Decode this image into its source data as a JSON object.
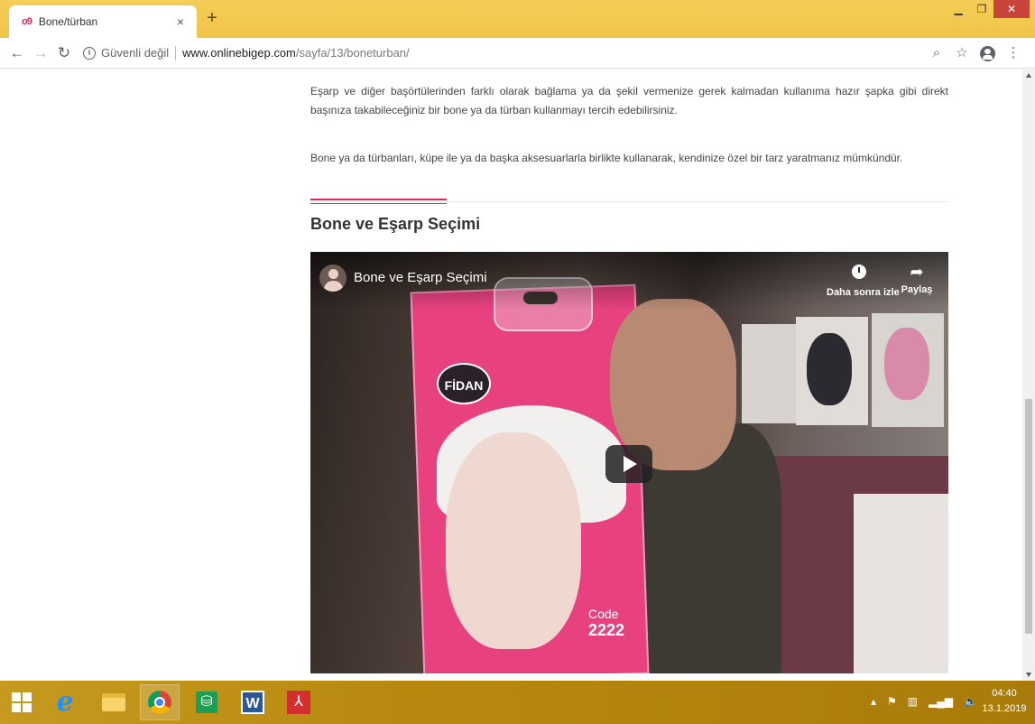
{
  "browser": {
    "tab_favicon": "o9",
    "tab_title": "Bone/türban",
    "tab_close": "×",
    "new_tab": "+",
    "security_label": "Güvenli değil",
    "url_host": "www.onlinebigep.com",
    "url_path": "/sayfa/13/boneturban/",
    "icons": [
      "back-icon",
      "forward-icon",
      "reload-icon",
      "info-icon",
      "zoom-icon",
      "star-icon",
      "profile-icon",
      "menu-icon"
    ]
  },
  "article": {
    "paragraph1": "Eşarp ve diğer başörtülerinden farklı olarak bağlama ya da şekil vermenize gerek kalmadan kullanıma hazır şapka gibi direkt başınıza takabileceğiniz bir bone ya da türban kullanmayı tercih edebilirsiniz.",
    "paragraph2": "Bone ya da türbanları, küpe ile ya da başka aksesuarlarla birlikte kullanarak, kendinize özel bir tarz yaratmanız mümkündür.",
    "heading": "Bone ve Eşarp Seçimi",
    "accent_color": "#e0245e"
  },
  "video": {
    "title": "Bone ve Eşarp Seçimi",
    "watch_later": "Daha sonra izle",
    "share": "Paylaş",
    "product_logo": "FİDAN",
    "product_code_label": "Code",
    "product_code": "2222"
  },
  "taskbar": {
    "apps": [
      "start-icon",
      "internet-explorer-icon",
      "file-explorer-icon",
      "chrome-icon",
      "store-icon",
      "word-icon",
      "acrobat-icon"
    ],
    "time": "04:40",
    "date": "13.1.2019"
  }
}
